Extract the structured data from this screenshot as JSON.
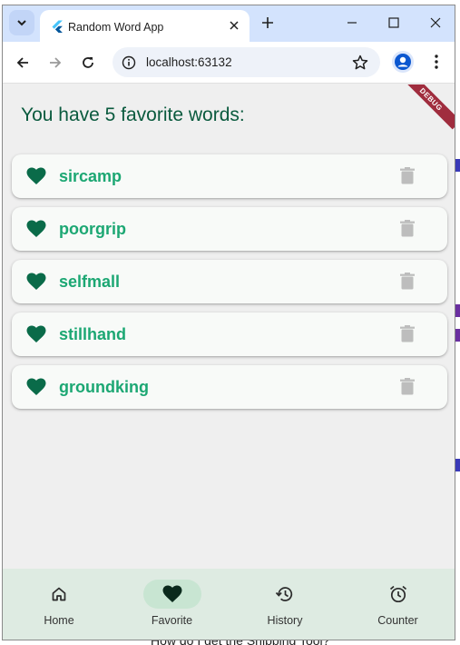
{
  "browser": {
    "tab_title": "Random Word App",
    "url": "localhost:63132"
  },
  "background_page": {
    "bottom_text": "How do I get the Snipping Tool?"
  },
  "app": {
    "debug_banner": "DEBUG",
    "heading": "You have 5 favorite words:",
    "favorites": [
      {
        "word": "sircamp"
      },
      {
        "word": "poorgrip"
      },
      {
        "word": "selfmall"
      },
      {
        "word": "stillhand"
      },
      {
        "word": "groundking"
      }
    ],
    "bottom_nav": [
      {
        "label": "Home",
        "icon": "home-icon",
        "active": false
      },
      {
        "label": "Favorite",
        "icon": "heart-icon",
        "active": true
      },
      {
        "label": "History",
        "icon": "history-icon",
        "active": false
      },
      {
        "label": "Counter",
        "icon": "alarm-icon",
        "active": false
      }
    ]
  },
  "colors": {
    "accent_dark": "#0a5a3e",
    "accent_word": "#1ca773",
    "nav_background": "#deebe2",
    "nav_active_pill": "#c8e5d2",
    "titlebar": "#d3e3fd"
  }
}
